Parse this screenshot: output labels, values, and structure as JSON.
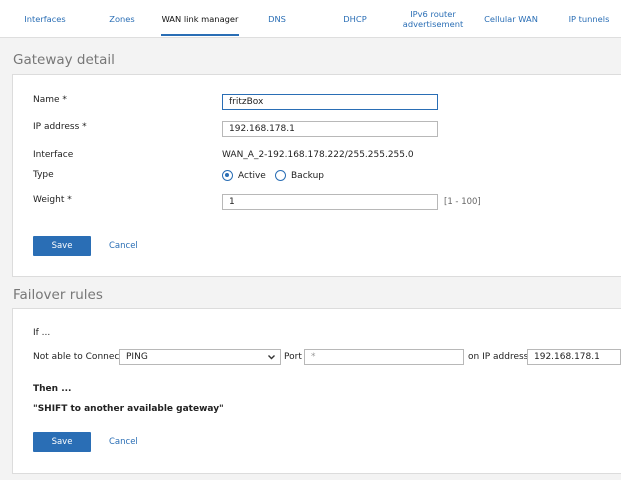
{
  "tabs": [
    {
      "label": "Interfaces"
    },
    {
      "label": "Zones"
    },
    {
      "label": "WAN link manager"
    },
    {
      "label": "DNS"
    },
    {
      "label": "DHCP"
    },
    {
      "label": "IPv6 router advertisement"
    },
    {
      "label": "Cellular WAN"
    },
    {
      "label": "IP tunnels"
    }
  ],
  "active_tab": "WAN link manager",
  "gateway": {
    "section_title": "Gateway detail",
    "name_label": "Name *",
    "name_value": "fritzBox",
    "ip_label": "IP address *",
    "ip_value": "192.168.178.1",
    "interface_label": "Interface",
    "interface_value": "WAN_A_2-192.168.178.222/255.255.255.0",
    "type_label": "Type",
    "type_active": "Active",
    "type_backup": "Backup",
    "type_selected": "Active",
    "weight_label": "Weight *",
    "weight_value": "1",
    "weight_hint": "[1 - 100]",
    "save_label": "Save",
    "cancel_label": "Cancel"
  },
  "failover": {
    "section_title": "Failover rules",
    "if_label": "If ...",
    "not_able_label": "Not able to Connect",
    "protocol_value": "PING",
    "port_label": "Port",
    "port_placeholder": "*",
    "on_ip_label": "on IP address",
    "ip_value": "192.168.178.1",
    "then_label": "Then ...",
    "action_text": "\"SHIFT to another available gateway\"",
    "save_label": "Save",
    "cancel_label": "Cancel"
  },
  "colors": {
    "accent": "#2a6eb5",
    "background": "#f3f3f3"
  }
}
